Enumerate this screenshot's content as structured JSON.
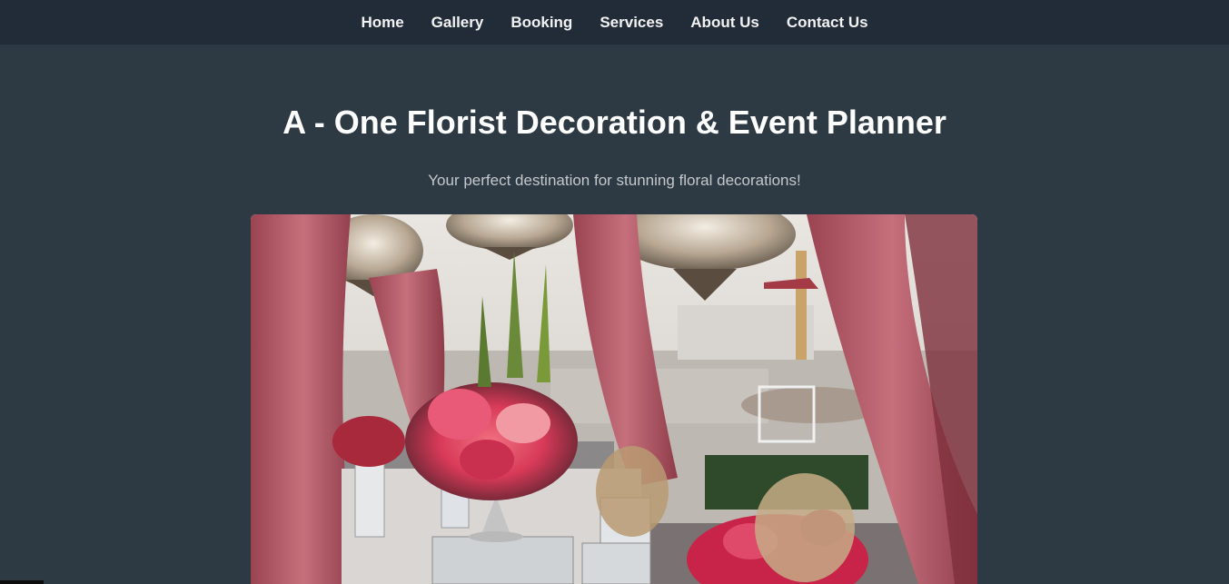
{
  "nav": {
    "items": [
      {
        "label": "Home"
      },
      {
        "label": "Gallery"
      },
      {
        "label": "Booking"
      },
      {
        "label": "Services"
      },
      {
        "label": "About Us"
      },
      {
        "label": "Contact Us"
      }
    ]
  },
  "hero": {
    "title": "A - One Florist Decoration & Event Planner",
    "subtitle": "Your perfect destination for stunning floral decorations!"
  },
  "colors": {
    "page_background": "#2e3a43",
    "navbar_background": "#212c38",
    "accent_drape": "#b8606c"
  }
}
